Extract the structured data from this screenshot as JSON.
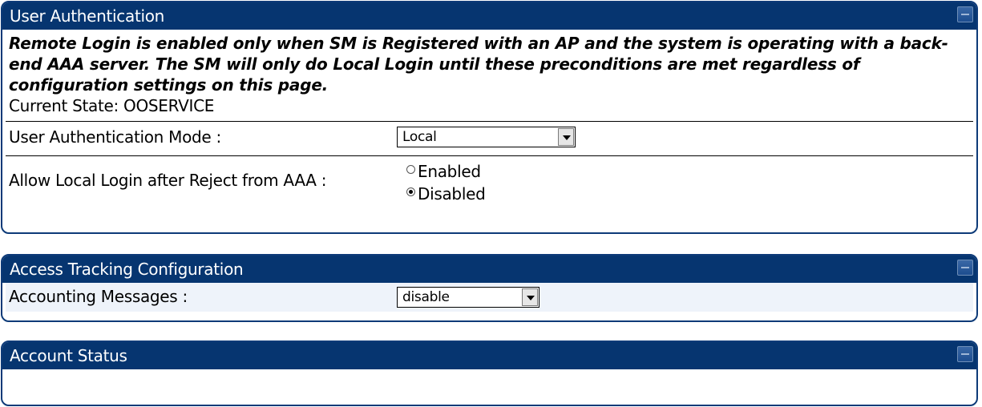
{
  "user_auth": {
    "title": "User Authentication",
    "notice": "Remote Login is enabled only when SM is Registered with an AP and the system is operating with a back-end AAA server. The SM will only do Local Login until these preconditions are met regardless of configuration settings on this page.",
    "current_state": "Current State: OOSERVICE",
    "mode_label": "User Authentication Mode :",
    "mode_value": "Local",
    "allow_local_label": "Allow Local Login after Reject from AAA :",
    "options": [
      "Enabled",
      "Disabled"
    ],
    "selected_option": "Disabled"
  },
  "access_tracking": {
    "title": "Access Tracking Configuration",
    "accounting_label": "Accounting Messages :",
    "accounting_value": "disable"
  },
  "account_status": {
    "title": "Account Status"
  },
  "icons": {
    "collapse": "collapse-icon",
    "dropdown": "chevron-down-icon",
    "radio": "radio-button-icon"
  },
  "colors": {
    "header_bg": "#063570",
    "header_text": "#ffffff",
    "border": "#0d3a78",
    "row_highlight": "#eef3fa"
  }
}
